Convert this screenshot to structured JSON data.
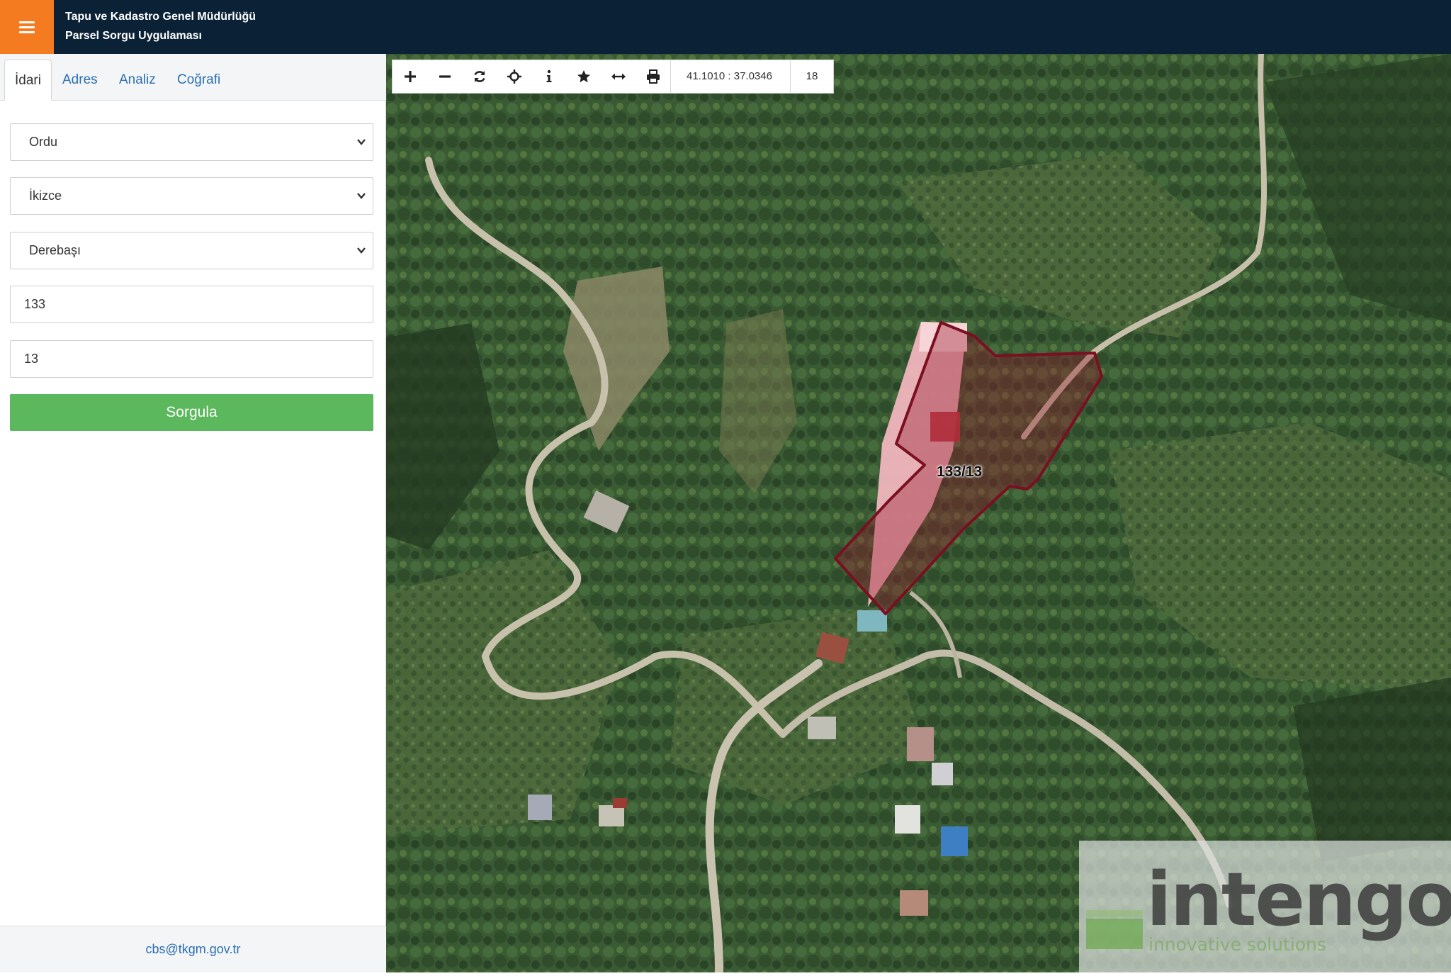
{
  "header": {
    "menu_icon": "hamburger-menu-icon",
    "accent_color": "#f47b20",
    "background_color": "#0b2236",
    "title_line1": "Tapu ve Kadastro Genel Müdürlüğü",
    "title_line2": "Parsel Sorgu Uygulaması"
  },
  "sidebar": {
    "tabs": [
      {
        "label": "İdari",
        "active": true
      },
      {
        "label": "Adres",
        "active": false
      },
      {
        "label": "Analiz",
        "active": false
      },
      {
        "label": "Coğrafi",
        "active": false
      }
    ],
    "province_select": {
      "value": "Ordu"
    },
    "district_select": {
      "value": "İkizce"
    },
    "neighborhood_select": {
      "value": "Derebaşı"
    },
    "block_input": {
      "value": "133"
    },
    "parcel_input": {
      "value": "13"
    },
    "query_button_label": "Sorgula",
    "query_button_color": "#5cb85c",
    "footer_email": "cbs@tkgm.gov.tr"
  },
  "map": {
    "toolbar_icons": [
      "zoom-in-icon",
      "zoom-out-icon",
      "refresh-icon",
      "locate-icon",
      "info-icon",
      "favorite-star-icon",
      "measure-icon",
      "print-icon"
    ],
    "coordinates": "41.1010 : 37.0346",
    "zoom_level": "18",
    "parcel_label": "133/13",
    "parcel_outline_color": "#7a0f22",
    "watermark": {
      "brand": "intengo",
      "tagline": "innovative solutions"
    }
  }
}
